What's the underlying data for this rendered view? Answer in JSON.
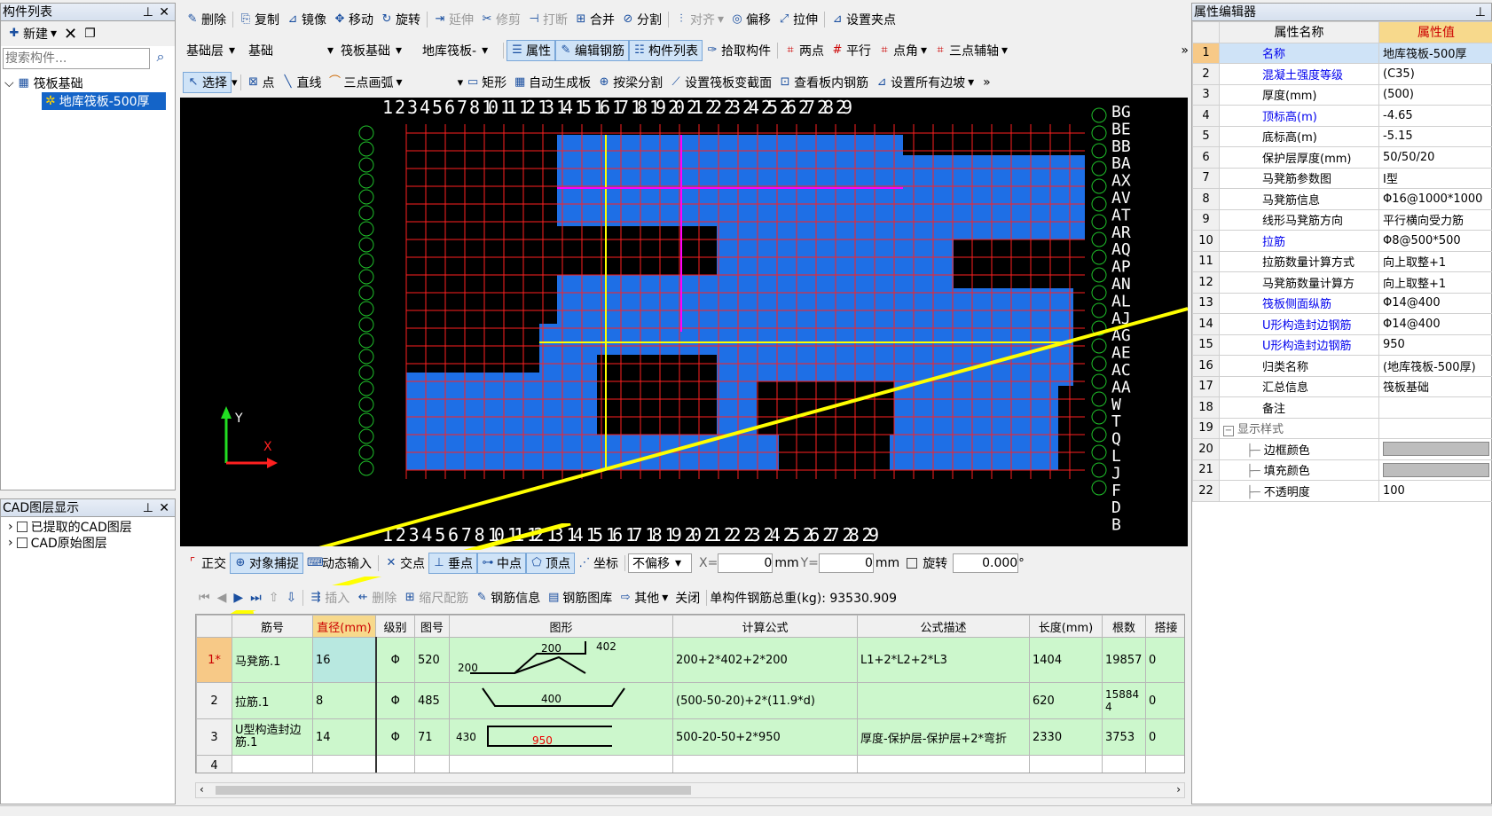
{
  "left_panel": {
    "title": "构件列表",
    "new_label": "新建",
    "search_placeholder": "搜索构件...",
    "tree_root": "筏板基础",
    "tree_child": "地库筏板-500厚"
  },
  "cad_panel": {
    "title": "CAD图层显示",
    "items": [
      "已提取的CAD图层",
      "CAD原始图层"
    ]
  },
  "toolbar1": [
    "删除",
    "复制",
    "镜像",
    "移动",
    "旋转",
    "延伸",
    "修剪",
    "打断",
    "合并",
    "分割",
    "对齐",
    "偏移",
    "拉伸",
    "设置夹点"
  ],
  "toolbar2": {
    "selects": [
      "基础层",
      "基础",
      "筏板基础",
      "地库筏板-"
    ],
    "buttons": [
      "属性",
      "编辑钢筋",
      "构件列表",
      "拾取构件",
      "两点",
      "平行",
      "点角",
      "三点辅轴"
    ]
  },
  "toolbar3": [
    "选择",
    "点",
    "直线",
    "三点画弧",
    "矩形",
    "自动生成板",
    "按梁分割",
    "设置筏板变截面",
    "查看板内钢筋",
    "设置所有边坡"
  ],
  "snapbar": {
    "buttons": [
      "正交",
      "对象捕捉",
      "动态输入",
      "交点",
      "垂点",
      "中点",
      "顶点",
      "坐标"
    ],
    "offset_select": "不偏移",
    "x_label": "X=",
    "x_value": "0",
    "y_label": "Y=",
    "y_value": "0",
    "unit": "mm",
    "rotate_label": "旋转",
    "rotate_value": "0.000",
    "degree": "°"
  },
  "rebar_toolbar": {
    "buttons": [
      "插入",
      "删除",
      "缩尺配筋",
      "钢筋信息",
      "钢筋图库",
      "其他",
      "关闭"
    ],
    "total": "单构件钢筋总重(kg): 93530.909"
  },
  "rebar_table": {
    "headers": [
      "",
      "筋号",
      "直径(mm)",
      "级别",
      "图号",
      "图形",
      "计算公式",
      "公式描述",
      "长度(mm)",
      "根数",
      "搭接"
    ],
    "rows": [
      {
        "idx": "1*",
        "name": "马凳筋.1",
        "dia": "16",
        "grade": "Φ",
        "fig": "520",
        "shape": [
          "200",
          "402",
          "200"
        ],
        "formula": "200+2*402+2*200",
        "desc": "L1+2*L2+2*L3",
        "len": "1404",
        "count": "19857",
        "lap": "0"
      },
      {
        "idx": "2",
        "name": "拉筋.1",
        "dia": "8",
        "grade": "Φ",
        "fig": "485",
        "shape": [
          "400"
        ],
        "formula": "(500-50-20)+2*(11.9*d)",
        "desc": "",
        "len": "620",
        "count": "158844",
        "lap": "0"
      },
      {
        "idx": "3",
        "name": "U型构造封边筋.1",
        "dia": "14",
        "grade": "Φ",
        "fig": "71",
        "shape": [
          "430",
          "950"
        ],
        "formula": "500-20-50+2*950",
        "desc": "厚度-保护层-保护层+2*弯折",
        "len": "2330",
        "count": "3753",
        "lap": "0"
      },
      {
        "idx": "4",
        "name": "",
        "dia": "",
        "grade": "",
        "fig": "",
        "shape": [],
        "formula": "",
        "desc": "",
        "len": "",
        "count": "",
        "lap": ""
      }
    ]
  },
  "property_panel": {
    "title": "属性编辑器",
    "col_name": "属性名称",
    "col_value": "属性值",
    "rows": [
      {
        "n": "1",
        "name": "名称",
        "value": "地库筏板-500厚"
      },
      {
        "n": "2",
        "name": "混凝土强度等级",
        "value": "(C35)"
      },
      {
        "n": "3",
        "name": "厚度(mm)",
        "value": "(500)"
      },
      {
        "n": "4",
        "name": "顶标高(m)",
        "value": "-4.65"
      },
      {
        "n": "5",
        "name": "底标高(m)",
        "value": "-5.15"
      },
      {
        "n": "6",
        "name": "保护层厚度(mm)",
        "value": "50/50/20"
      },
      {
        "n": "7",
        "name": "马凳筋参数图",
        "value": "Ⅰ型"
      },
      {
        "n": "8",
        "name": "马凳筋信息",
        "value": "Φ16@1000*1000"
      },
      {
        "n": "9",
        "name": "线形马凳筋方向",
        "value": "平行横向受力筋"
      },
      {
        "n": "10",
        "name": "拉筋",
        "value": "Φ8@500*500"
      },
      {
        "n": "11",
        "name": "拉筋数量计算方式",
        "value": "向上取整+1"
      },
      {
        "n": "12",
        "name": "马凳筋数量计算方",
        "value": "向上取整+1"
      },
      {
        "n": "13",
        "name": "筏板侧面纵筋",
        "value": "Φ14@400"
      },
      {
        "n": "14",
        "name": "U形构造封边钢筋",
        "value": "Φ14@400"
      },
      {
        "n": "15",
        "name": "U形构造封边钢筋",
        "value": "950"
      },
      {
        "n": "16",
        "name": "归类名称",
        "value": "(地库筏板-500厚)"
      },
      {
        "n": "17",
        "name": "汇总信息",
        "value": "筏板基础"
      },
      {
        "n": "18",
        "name": "备注",
        "value": ""
      },
      {
        "n": "19",
        "name": "显示样式",
        "value": ""
      },
      {
        "n": "20",
        "name": "边框颜色",
        "value": ""
      },
      {
        "n": "21",
        "name": "填充颜色",
        "value": ""
      },
      {
        "n": "22",
        "name": "不透明度",
        "value": "100"
      }
    ]
  },
  "canvas": {
    "axis_top": "1 2 3 4 5 6 7 8 10 11 12 13 14 15 16 17 18 19 20 21 22 23 24 25 26 27 28 29",
    "axis_right": [
      "BG",
      "BE",
      "BB",
      "BA",
      "AX",
      "AV",
      "AT",
      "AR",
      "AQ",
      "AP",
      "AN",
      "AL",
      "AJ",
      "AG",
      "AE",
      "AC",
      "AA",
      "W",
      "T",
      "Q",
      "L",
      "J",
      "F",
      "D",
      "B"
    ],
    "y_label": "Y",
    "x_label": "X"
  },
  "colors": {
    "slab_blue": "#1e6fe6",
    "grid_red": "#ff2020",
    "bg_black": "#000000",
    "row_green": "#ccf7cc",
    "arrow_yellow": "#ffff00"
  }
}
